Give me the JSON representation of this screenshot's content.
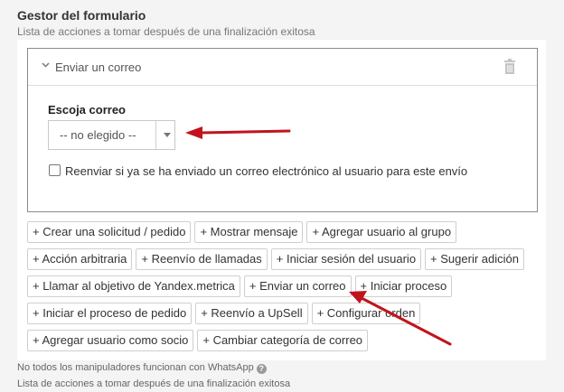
{
  "header": {
    "title": "Gestor del formulario",
    "subtitle": "Lista de acciones a tomar después de una finalización exitosa"
  },
  "action": {
    "title": "Enviar un correo",
    "field_label": "Escoja correo",
    "select_value": "-- no elegido --",
    "checkbox_label": "Reenviar si ya se ha enviado un correo electrónico al usuario para este envío",
    "checkbox_checked": false
  },
  "chips": [
    [
      "+ Crear una solicitud / pedido",
      "+ Mostrar mensaje",
      "+ Agregar usuario al grupo"
    ],
    [
      "+ Acción arbitraria",
      "+ Reenvío de llamadas",
      "+ Iniciar sesión del usuario",
      "+ Sugerir adición"
    ],
    [
      "+ Llamar al objetivo de Yandex.metrica",
      "+ Enviar un correo",
      "+ Iniciar proceso"
    ],
    [
      "+ Iniciar el proceso de pedido",
      "+ Reenvío a UpSell",
      "+ Configurar orden"
    ],
    [
      "+ Agregar usuario como socio",
      "+ Cambiar categoría de correo"
    ]
  ],
  "footer": {
    "note": "No todos los manipuladores funcionan con WhatsApp",
    "help_icon": "?",
    "subtitle": "Lista de acciones a tomar después de una finalización exitosa"
  },
  "colors": {
    "annotation_arrow": "#c0141c"
  }
}
